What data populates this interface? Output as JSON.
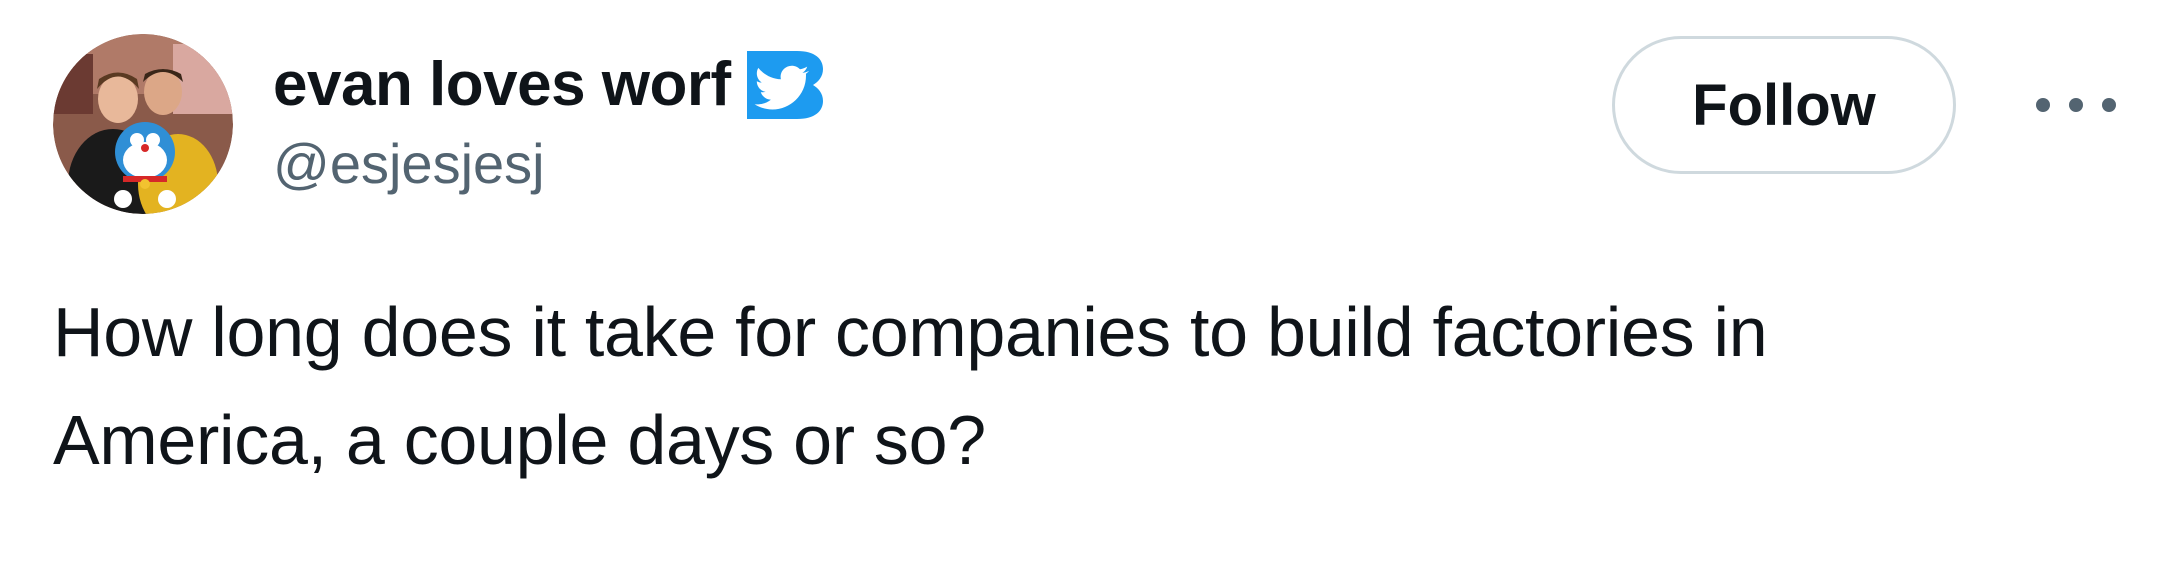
{
  "author": {
    "display_name": "evan loves worf",
    "handle": "@esjesjesj",
    "verified_badge_icon": "twitter-bird-badge-icon",
    "avatar": "avatar-photo"
  },
  "actions": {
    "follow_label": "Follow",
    "more_icon": "more-dots-icon"
  },
  "tweet": {
    "text_lines": [
      "How long does it take for companies to build factories in",
      "America, a couple days or so?"
    ]
  },
  "colors": {
    "text_primary": "#0f1419",
    "text_secondary": "#536471",
    "badge_blue": "#1d9bf0",
    "follow_border": "#cfd9de",
    "background": "#ffffff"
  }
}
